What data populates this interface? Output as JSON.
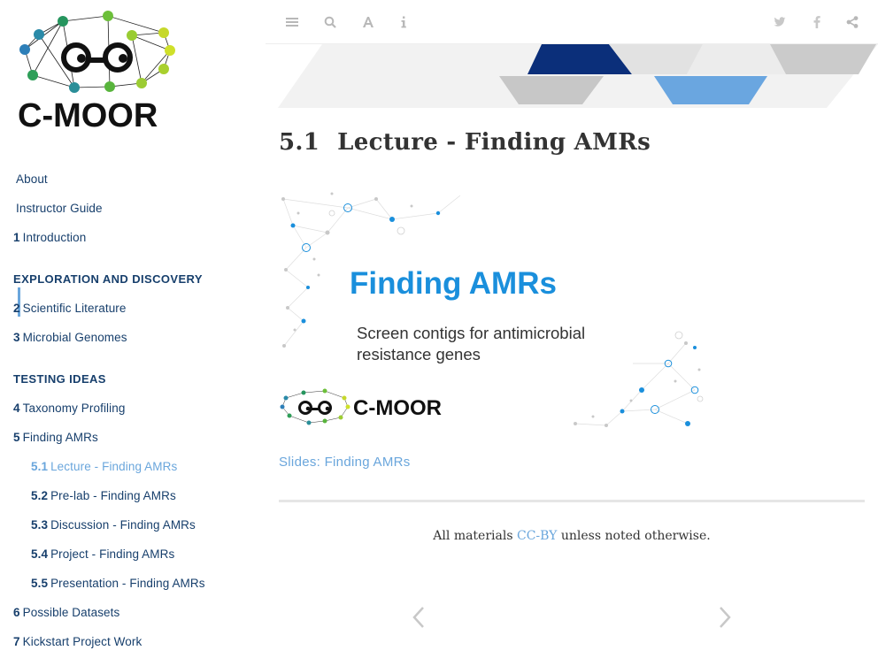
{
  "brand": {
    "name": "C-MOOR"
  },
  "colors": {
    "nav_text": "#173f6c",
    "active": "#6aa6dc",
    "slide_title": "#1a8fdc",
    "banner_dark": "#0b2f7a",
    "banner_light": "#6aa6dc"
  },
  "sidebar": {
    "items": [
      {
        "num": "",
        "label": "About"
      },
      {
        "num": "",
        "label": "Instructor Guide"
      },
      {
        "num": "1",
        "label": "Introduction"
      },
      {
        "header": "EXPLORATION AND DISCOVERY"
      },
      {
        "num": "2",
        "label": "Scientific Literature"
      },
      {
        "num": "3",
        "label": "Microbial Genomes"
      },
      {
        "header": "TESTING IDEAS"
      },
      {
        "num": "4",
        "label": "Taxonomy Profiling"
      },
      {
        "num": "5",
        "label": "Finding AMRs"
      },
      {
        "num": "5.1",
        "label": "Lecture - Finding AMRs",
        "active": true
      },
      {
        "num": "5.2",
        "label": "Pre-lab - Finding AMRs"
      },
      {
        "num": "5.3",
        "label": "Discussion - Finding AMRs"
      },
      {
        "num": "5.4",
        "label": "Project - Finding AMRs"
      },
      {
        "num": "5.5",
        "label": "Presentation - Finding AMRs"
      },
      {
        "num": "6",
        "label": "Possible Datasets"
      },
      {
        "num": "7",
        "label": "Kickstart Project Work"
      }
    ]
  },
  "toolbar": {
    "left_icons": [
      "menu-icon",
      "search-icon",
      "font-icon",
      "info-icon"
    ],
    "right_icons": [
      "twitter-icon",
      "facebook-icon",
      "share-icon"
    ]
  },
  "main": {
    "section_number": "5.1",
    "title": "Lecture - Finding AMRs",
    "slide": {
      "title": "Finding AMRs",
      "subtitle": "Screen contigs for antimicrobial resistance genes",
      "brand": "C-MOOR"
    },
    "slides_link": "Slides: Finding AMRs",
    "footer": {
      "prefix": "All materials ",
      "link": "CC-BY",
      "suffix": " unless noted otherwise."
    }
  }
}
